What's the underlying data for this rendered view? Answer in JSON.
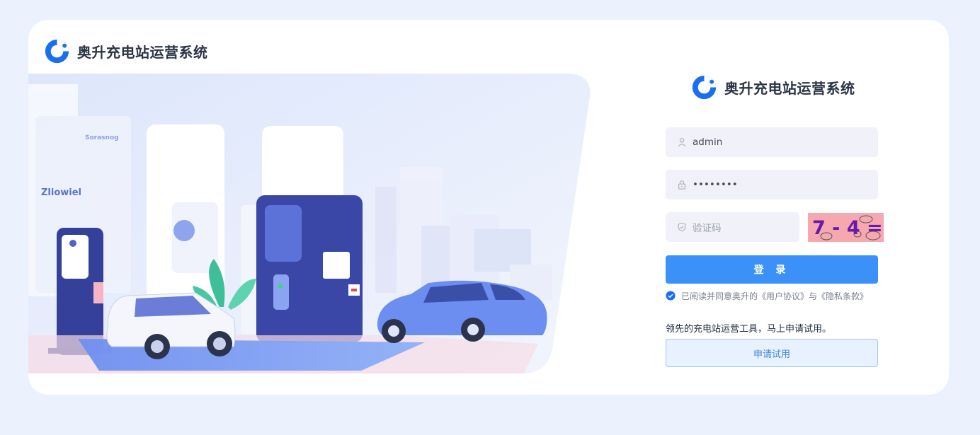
{
  "app": {
    "brand_name": "奥升充电站运营系统",
    "brand_color": "#1a6ff0",
    "logo_icon": "brand-ring-logo"
  },
  "illustration": {
    "sign_text_left": "Zliowiel",
    "sign_text_top": "Sorasnog",
    "icon_names": [
      "ev-charger-left",
      "ev-charger-center",
      "white-car",
      "blue-car",
      "plant",
      "buildings"
    ]
  },
  "login": {
    "username": {
      "value": "admin",
      "icon": "user-icon"
    },
    "password": {
      "value": "••••••••",
      "icon": "lock-icon"
    },
    "captcha": {
      "placeholder": "验证码",
      "icon": "shield-icon",
      "image_text": "7 - 4 ="
    },
    "submit_label": "登 录",
    "agreement": {
      "checked": true,
      "text": "已阅读并同意奥升的《用户协议》与《隐私条款》"
    },
    "promo_text": "领先的充电站运营工具，马上申请试用。",
    "trial_label": "申请试用",
    "accent_color": "#3b91f7"
  }
}
